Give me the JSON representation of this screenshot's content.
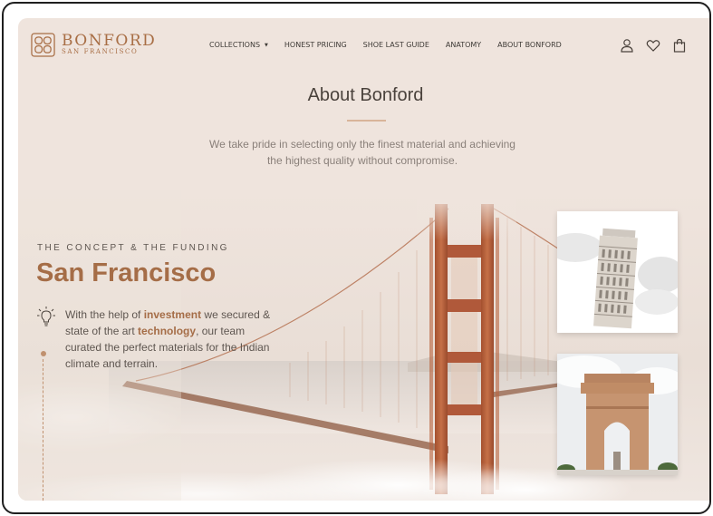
{
  "brand": {
    "name": "BONFORD",
    "tagline": "SAN FRANCISCO",
    "color": "#a86e45",
    "icon": "ornamental-logo-icon"
  },
  "nav": {
    "items": [
      {
        "label": "COLLECTIONS",
        "has_dropdown": true
      },
      {
        "label": "HONEST PRICING"
      },
      {
        "label": "SHOE LAST GUIDE"
      },
      {
        "label": "ANATOMY"
      },
      {
        "label": "ABOUT BONFORD"
      }
    ]
  },
  "header_icons": [
    "user-icon",
    "heart-icon",
    "shopping-bag-icon"
  ],
  "about": {
    "title": "About Bonford",
    "text_line1": "We take pride in selecting only the finest material and achieving",
    "text_line2": "the highest quality without compromise."
  },
  "concept": {
    "eyebrow": "THE CONCEPT & THE FUNDING",
    "title": "San Francisco",
    "icon": "lightbulb-icon",
    "text_part1": "With the help of ",
    "highlight1": "investment",
    "text_part2": " we secured & state of the art ",
    "highlight2": "technology",
    "text_part3": ", our team curated the perfect materials for the Indian climate and terrain."
  },
  "images": [
    {
      "name": "golden-gate-bridge-image"
    },
    {
      "name": "leaning-tower-of-pisa-image"
    },
    {
      "name": "india-gate-image"
    }
  ],
  "colors": {
    "background": "#efe4dd",
    "accent": "#a56d47",
    "bridge": "#b5603c",
    "text": "#5e5650"
  }
}
